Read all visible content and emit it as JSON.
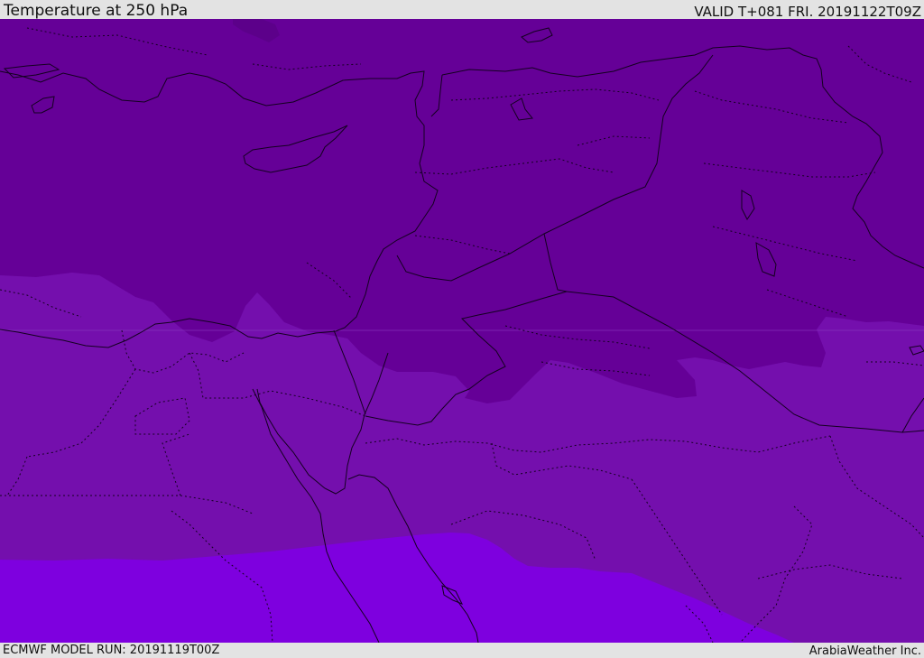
{
  "header": {
    "title": "Temperature at 250 hPa",
    "valid": "VALID T+081 FRI. 20191122T09Z"
  },
  "footer": {
    "model_run": "ECMWF MODEL RUN: 20191119T00Z",
    "credit": "ArabiaWeather Inc."
  },
  "map": {
    "colors": {
      "cold_band": "#650097",
      "cool_band": "#740fad",
      "mid_band": "#7e00df",
      "coldest_patch": "#5c008a",
      "coastline": "#140020",
      "border": "#140020"
    }
  }
}
